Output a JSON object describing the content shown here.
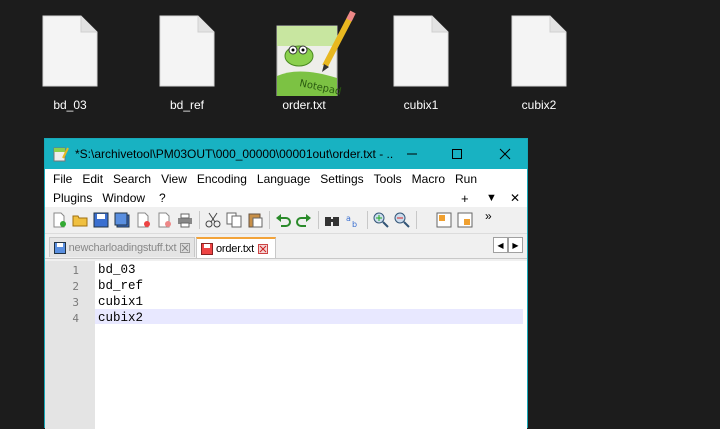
{
  "desktop": {
    "icons": [
      {
        "label": "bd_03",
        "icon": "blank-file-icon"
      },
      {
        "label": "bd_ref",
        "icon": "blank-file-icon"
      },
      {
        "label": "order.txt",
        "icon": "notepad-plus-plus-file-icon"
      },
      {
        "label": "cubix1",
        "icon": "blank-file-icon"
      },
      {
        "label": "cubix2",
        "icon": "blank-file-icon"
      }
    ]
  },
  "window": {
    "title": "*S:\\archivetool\\PM03OUT\\000_00000\\00001out\\order.txt - ...",
    "title_color": "#18b2c2",
    "menu_row1": [
      "File",
      "Edit",
      "Search",
      "View",
      "Encoding",
      "Language",
      "Settings",
      "Tools",
      "Macro",
      "Run"
    ],
    "menu_row2": [
      "Plugins",
      "Window",
      "?"
    ],
    "menu_controls": {
      "plus": "+",
      "dropdown": "▼",
      "close": "✕"
    },
    "tabs": [
      {
        "label": "newcharloadingstuff.txt",
        "active": false
      },
      {
        "label": "order.txt",
        "active": true
      }
    ],
    "editor": {
      "line_numbers": [
        "1",
        "2",
        "3",
        "4"
      ],
      "lines": [
        "bd_03",
        "bd_ref",
        "cubix1",
        "cubix2"
      ],
      "current_line": 4,
      "current_line_color": "#e8e8ff"
    }
  }
}
